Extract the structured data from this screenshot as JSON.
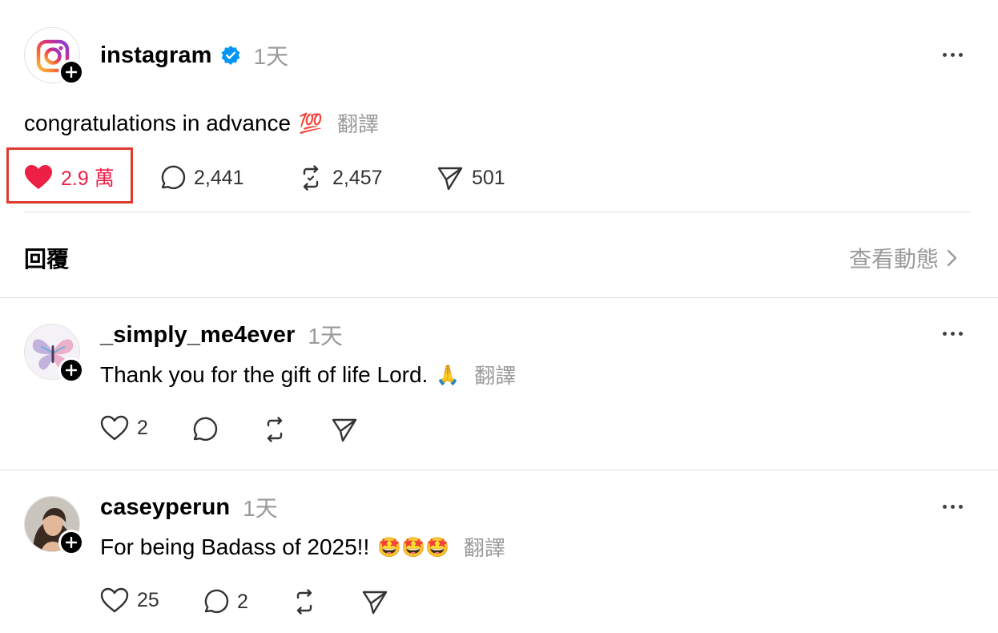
{
  "post": {
    "username": "instagram",
    "verified": true,
    "time": "1天",
    "text": "congratulations in advance",
    "emoji": "💯",
    "translate": "翻譯",
    "likes": "2.9 萬",
    "comments": "2,441",
    "reposts": "2,457",
    "shares": "501",
    "like_color": "#ed1f45"
  },
  "replies_header": {
    "title": "回覆",
    "view_activity": "查看動態"
  },
  "replies": [
    {
      "username": "_simply_me4ever",
      "time": "1天",
      "text": "Thank you for the gift of life Lord.",
      "emoji": "🙏",
      "translate": "翻譯",
      "likes": "2",
      "comments": ""
    },
    {
      "username": "caseyperun",
      "time": "1天",
      "text": "For being Badass of 2025!!",
      "emoji": "🤩🤩🤩",
      "translate": "翻譯",
      "likes": "25",
      "comments": "2"
    }
  ],
  "highlight_color": "#e03a2f"
}
